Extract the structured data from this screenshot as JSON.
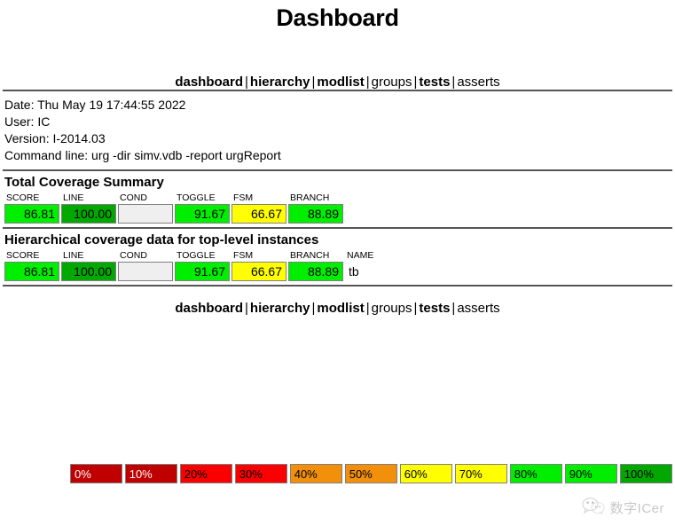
{
  "page": {
    "title": "Dashboard"
  },
  "nav": {
    "items": [
      {
        "label": "dashboard",
        "bold": true
      },
      {
        "label": "hierarchy",
        "bold": true
      },
      {
        "label": "modlist",
        "bold": true
      },
      {
        "label": "groups",
        "bold": false
      },
      {
        "label": "tests",
        "bold": true
      },
      {
        "label": "asserts",
        "bold": false
      }
    ],
    "separator": "|"
  },
  "meta": {
    "lines": [
      "Date: Thu May 19 17:44:55 2022",
      "User: IC",
      "Version: I-2014.03",
      "Command line: urg -dir simv.vdb -report urgReport"
    ]
  },
  "total_summary": {
    "heading": "Total Coverage Summary",
    "columns": [
      "SCORE",
      "LINE",
      "COND",
      "TOGGLE",
      "FSM",
      "BRANCH"
    ],
    "values": [
      "86.81",
      "100.00",
      "",
      "91.67",
      "66.67",
      "88.89"
    ],
    "colors": [
      "#00EE00",
      "#00A800",
      "#EFEFEF",
      "#00EE00",
      "#FFFF00",
      "#00EE00"
    ]
  },
  "hierarchical": {
    "heading": "Hierarchical coverage data for top-level instances",
    "columns": [
      "SCORE",
      "LINE",
      "COND",
      "TOGGLE",
      "FSM",
      "BRANCH",
      "NAME"
    ],
    "rows": [
      {
        "values": [
          "86.81",
          "100.00",
          "",
          "91.67",
          "66.67",
          "88.89"
        ],
        "colors": [
          "#00EE00",
          "#00A800",
          "#EFEFEF",
          "#00EE00",
          "#FFFF00",
          "#00EE00"
        ],
        "name": "tb"
      }
    ]
  },
  "legend": {
    "swatches": [
      {
        "label": "0%",
        "color": "#C00000",
        "text": "#FFFFFF"
      },
      {
        "label": "10%",
        "color": "#C00000",
        "text": "#FFFFFF"
      },
      {
        "label": "20%",
        "color": "#FA0000",
        "text": "#000000"
      },
      {
        "label": "30%",
        "color": "#FA0000",
        "text": "#000000"
      },
      {
        "label": "40%",
        "color": "#F2900C",
        "text": "#000000"
      },
      {
        "label": "50%",
        "color": "#F2900C",
        "text": "#000000"
      },
      {
        "label": "60%",
        "color": "#FFFF00",
        "text": "#000000"
      },
      {
        "label": "70%",
        "color": "#FFFF00",
        "text": "#000000"
      },
      {
        "label": "80%",
        "color": "#00EE00",
        "text": "#000000"
      },
      {
        "label": "90%",
        "color": "#00EE00",
        "text": "#000000"
      },
      {
        "label": "100%",
        "color": "#00A800",
        "text": "#000000"
      }
    ]
  },
  "watermark": {
    "text": "数字ICer",
    "icon": "wechat-logo-icon"
  }
}
